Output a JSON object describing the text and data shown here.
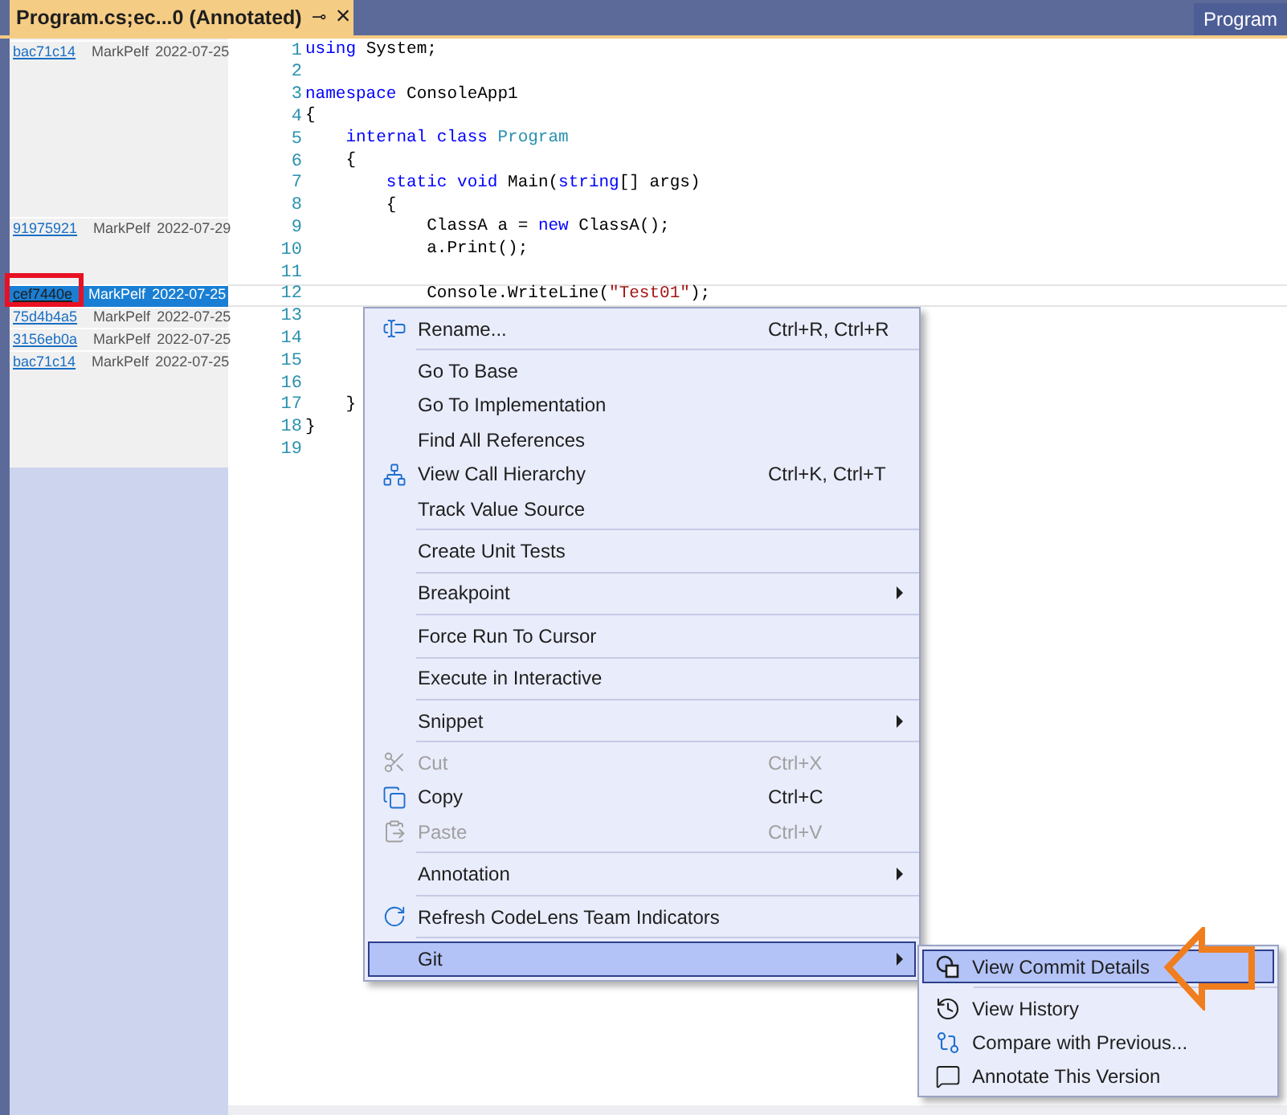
{
  "tabs": [
    {
      "title": "Program.cs;ec...0 (Annotated)",
      "selected": true,
      "pin": "⊸",
      "close": "×"
    },
    {
      "title": "Program",
      "selected": false
    }
  ],
  "code": {
    "lines": [
      {
        "number": "1",
        "tokens": [
          {
            "text": "using",
            "kind": "keyword"
          },
          {
            "text": " System;",
            "kind": "plain"
          }
        ],
        "blame": {
          "hash": "bac71c14",
          "author": "MarkPelf",
          "date": "2022-07-25",
          "selected": false
        }
      },
      {
        "number": "2"
      },
      {
        "number": "3",
        "tokens": [
          {
            "text": "namespace",
            "kind": "keyword"
          },
          {
            "text": " ConsoleApp1",
            "kind": "plain"
          }
        ]
      },
      {
        "number": "4",
        "tokens": [
          {
            "text": "{",
            "kind": "plain"
          }
        ]
      },
      {
        "number": "5",
        "tokens": [
          {
            "text": "    internal class",
            "kind": "keyword"
          },
          {
            "text": " Program",
            "kind": "type"
          }
        ]
      },
      {
        "number": "6",
        "tokens": [
          {
            "text": "    {",
            "kind": "plain"
          }
        ]
      },
      {
        "number": "7",
        "tokens": [
          {
            "text": "        static void",
            "kind": "keyword"
          },
          {
            "text": " Main(",
            "kind": "plain"
          },
          {
            "text": "string",
            "kind": "keyword"
          },
          {
            "text": "[] args)",
            "kind": "plain"
          }
        ]
      },
      {
        "number": "8",
        "tokens": [
          {
            "text": "        {",
            "kind": "plain"
          }
        ]
      },
      {
        "number": "9",
        "tokens": [
          {
            "text": "            ClassA a = ",
            "kind": "plain"
          },
          {
            "text": "new",
            "kind": "keyword"
          },
          {
            "text": " ClassA();",
            "kind": "plain"
          }
        ],
        "blame": {
          "hash": "91975921",
          "author": "MarkPelf",
          "date": "2022-07-29",
          "selected": false
        }
      },
      {
        "number": "10",
        "tokens": [
          {
            "text": "            a.Print();",
            "kind": "plain"
          }
        ]
      },
      {
        "number": "11"
      },
      {
        "number": "12",
        "current": true,
        "tokens": [
          {
            "text": "            Console.WriteLine(",
            "kind": "plain"
          },
          {
            "text": "\"Test01\"",
            "kind": "string"
          },
          {
            "text": ");",
            "kind": "plain"
          }
        ],
        "blame": {
          "hash": "cef7440e",
          "author": "MarkPelf",
          "date": "2022-07-25",
          "selected": true
        }
      },
      {
        "number": "13",
        "blame": {
          "hash": "75d4b4a5",
          "author": "MarkPelf",
          "date": "2022-07-25",
          "selected": false
        }
      },
      {
        "number": "14",
        "blame": {
          "hash": "3156eb0a",
          "author": "MarkPelf",
          "date": "2022-07-25",
          "selected": false
        }
      },
      {
        "number": "15",
        "blame": {
          "hash": "bac71c14",
          "author": "MarkPelf",
          "date": "2022-07-25",
          "selected": false
        }
      },
      {
        "number": "16"
      },
      {
        "number": "17",
        "tokens": [
          {
            "text": "    }",
            "kind": "plain"
          }
        ]
      },
      {
        "number": "18",
        "tokens": [
          {
            "text": "}",
            "kind": "plain"
          }
        ]
      },
      {
        "number": "19"
      }
    ]
  },
  "context_menu": {
    "groups": [
      [
        {
          "label": "Rename...",
          "shortcut": "Ctrl+R, Ctrl+R",
          "disabled": false,
          "submenu": false,
          "selected": false
        }
      ],
      [
        {
          "label": "Go To Base",
          "disabled": false,
          "submenu": false,
          "selected": false
        },
        {
          "label": "Go To Implementation",
          "disabled": false,
          "submenu": false,
          "selected": false
        },
        {
          "label": "Find All References",
          "disabled": false,
          "submenu": false,
          "selected": false
        },
        {
          "label": "View Call Hierarchy",
          "shortcut": "Ctrl+K, Ctrl+T",
          "disabled": false,
          "submenu": false,
          "selected": false
        },
        {
          "label": "Track Value Source",
          "disabled": false,
          "submenu": false,
          "selected": false
        }
      ],
      [
        {
          "label": "Create Unit Tests",
          "disabled": false,
          "submenu": false,
          "selected": false
        }
      ],
      [
        {
          "label": "Breakpoint",
          "disabled": false,
          "submenu": true,
          "selected": false
        }
      ],
      [
        {
          "label": "Force Run To Cursor",
          "disabled": false,
          "submenu": false,
          "selected": false
        }
      ],
      [
        {
          "label": "Execute in Interactive",
          "disabled": false,
          "submenu": false,
          "selected": false
        }
      ],
      [
        {
          "label": "Snippet",
          "disabled": false,
          "submenu": true,
          "selected": false
        }
      ],
      [
        {
          "label": "Cut",
          "shortcut": "Ctrl+X",
          "disabled": true,
          "submenu": false,
          "selected": false
        },
        {
          "label": "Copy",
          "shortcut": "Ctrl+C",
          "disabled": false,
          "submenu": false,
          "selected": false
        },
        {
          "label": "Paste",
          "shortcut": "Ctrl+V",
          "disabled": true,
          "submenu": false,
          "selected": false
        }
      ],
      [
        {
          "label": "Annotation",
          "disabled": false,
          "submenu": true,
          "selected": false
        }
      ],
      [
        {
          "label": "Refresh CodeLens Team Indicators",
          "disabled": false,
          "submenu": false,
          "selected": false
        }
      ],
      [
        {
          "label": "Git",
          "disabled": false,
          "submenu": true,
          "selected": true
        }
      ]
    ]
  },
  "git_submenu": {
    "groups": [
      [
        {
          "label": "View Commit Details",
          "selected": true
        }
      ],
      [
        {
          "label": "View History",
          "selected": false
        },
        {
          "label": "Compare with Previous...",
          "selected": false
        },
        {
          "label": "Annotate This Version",
          "selected": false
        }
      ]
    ]
  }
}
